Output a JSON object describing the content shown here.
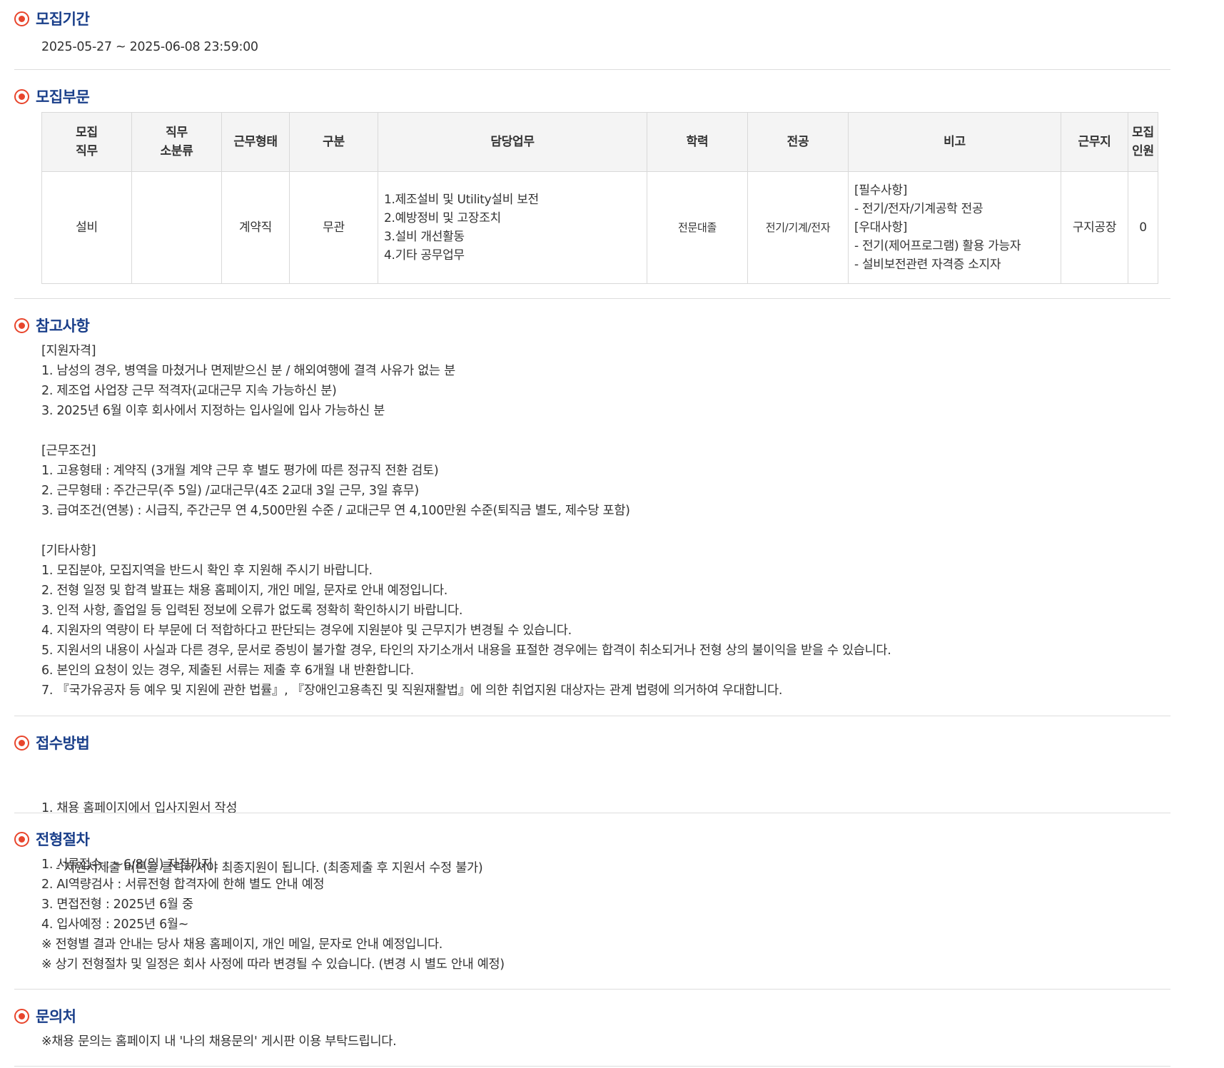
{
  "period": {
    "title": "모집기간",
    "value": "2025-05-27 ~ 2025-06-08 23:59:00"
  },
  "division": {
    "title": "모집부문",
    "headers": [
      [
        "모집",
        "직무"
      ],
      [
        "직무",
        "소분류"
      ],
      [
        "근무형태"
      ],
      [
        "구분"
      ],
      [
        "담당업무"
      ],
      [
        "학력"
      ],
      [
        "전공"
      ],
      [
        "비고"
      ],
      [
        "근무지"
      ],
      [
        "모집",
        "인원"
      ]
    ],
    "row": {
      "job": "설비",
      "subcategory": "",
      "employment_type": "계약직",
      "category": "무관",
      "duties": [
        "1.제조설비 및 Utility설비 보전",
        "2.예방정비 및 고장조치",
        "3.설비 개선활동",
        "4.기타 공무업무"
      ],
      "education": "전문대졸",
      "major": "전기/기계/전자",
      "notes": [
        "[필수사항]",
        "- 전기/전자/기계공학 전공",
        "[우대사항]",
        "- 전기(제어프로그램) 활용 가능자",
        "- 설비보전관련 자격증 소지자"
      ],
      "location": "구지공장",
      "headcount": "0"
    }
  },
  "reference": {
    "title": "참고사항",
    "lines": [
      "[지원자격]",
      "1. 남성의 경우, 병역을 마쳤거나 면제받으신 분 / 해외여행에 결격 사유가 없는 분",
      "2. 제조업 사업장 근무 적격자(교대근무 지속 가능하신 분)",
      "3. 2025년 6월 이후 회사에서 지정하는 입사일에 입사 가능하신 분",
      "",
      "[근무조건]",
      "1. 고용형태 : 계약직 (3개월 계약 근무 후 별도 평가에 따른 정규직 전환 검토)",
      "2. 근무형태 : 주간근무(주 5일) /교대근무(4조 2교대 3일 근무, 3일 휴무)",
      "3. 급여조건(연봉) : 시급직, 주간근무 연 4,500만원 수준 / 교대근무 연 4,100만원 수준(퇴직금 별도, 제수당 포함)",
      "",
      "[기타사항]",
      "1. 모집분야, 모집지역을 반드시 확인 후 지원해 주시기 바랍니다.",
      "2. 전형 일정 및 합격 발표는 채용 홈페이지, 개인 메일, 문자로 안내 예정입니다.",
      "3. 인적 사항, 졸업일 등 입력된 정보에 오류가 없도록 정확히 확인하시기 바랍니다.",
      "4. 지원자의 역량이 타 부문에 더 적합하다고 판단되는 경우에 지원분야 및 근무지가 변경될 수 있습니다.",
      "5. 지원서의 내용이 사실과 다른 경우, 문서로 증빙이 불가할 경우, 타인의 자기소개서 내용을 표절한 경우에는 합격이 취소되거나 전형 상의 불이익을 받을 수 있습니다.",
      "6. 본인의 요청이 있는 경우, 제출된 서류는 제출 후 6개월 내 반환합니다.",
      "7. 『국가유공자 등 예우 및 지원에 관한 법률』, 『장애인고용촉진 및 직원재활법』에 의한 취업지원 대상자는 관계 법령에 의거하여 우대합니다."
    ]
  },
  "apply": {
    "title": "접수방법",
    "lines": [
      "1. 채용 홈페이지에서 입사지원서 작성",
      "- 지원서제출 버튼을 클릭하셔야 최종지원이 됩니다. (최종제출 후 지원서 수정 불가)"
    ]
  },
  "process": {
    "title": "전형절차",
    "lines": [
      "1. 서류접수 : ~6/8(일) 자정까지",
      "2. AI역량검사 : 서류전형 합격자에 한해 별도 안내 예정",
      "3. 면접전형 : 2025년 6월 중",
      "4. 입사예정 : 2025년 6월~",
      "※ 전형별 결과 안내는 당사 채용 홈페이지, 개인 메일, 문자로 안내 예정입니다.",
      "※ 상기 전형절차 및 일정은 회사 사정에 따라 변경될 수 있습니다. (변경 시 별도 안내 예정)"
    ]
  },
  "contact": {
    "title": "문의처",
    "value": "※채용 문의는 홈페이지 내 '나의 채용문의' 게시판 이용 부탁드립니다."
  }
}
